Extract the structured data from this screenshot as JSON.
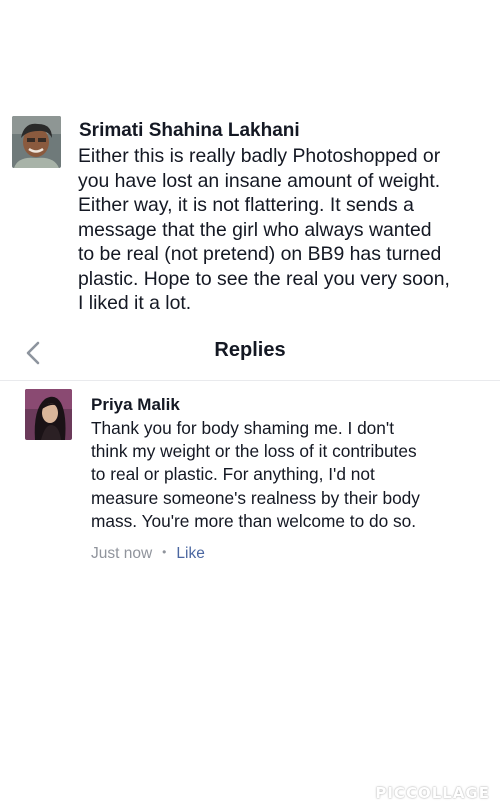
{
  "comment": {
    "author": "Srimati Shahina Lakhani",
    "lines": [
      "Either this is really badly Photoshopped or",
      "you have lost an insane amount of weight.",
      "Either way, it is not flattering. It sends a",
      "message that the girl who always wanted",
      "to be real (not pretend) on BB9 has turned",
      "plastic. Hope to see the real you very soon,",
      "I liked it a lot."
    ]
  },
  "replies_header": {
    "title": "Replies",
    "back_icon": "chevron-left-icon"
  },
  "reply": {
    "author": "Priya Malik",
    "lines": [
      "Thank you for body shaming me. I don't",
      "think my weight or the loss of it contributes",
      "to real or plastic. For anything, I'd not",
      "measure someone's realness by their body",
      "mass. You're more than welcome to do so."
    ],
    "time": "Just now",
    "separator": "•",
    "like_label": "Like"
  },
  "watermark": "PICCOLLAGE",
  "colors": {
    "text": "#141823",
    "muted": "#90949c",
    "link": "#4b67a1",
    "divider": "#e9eaed"
  }
}
